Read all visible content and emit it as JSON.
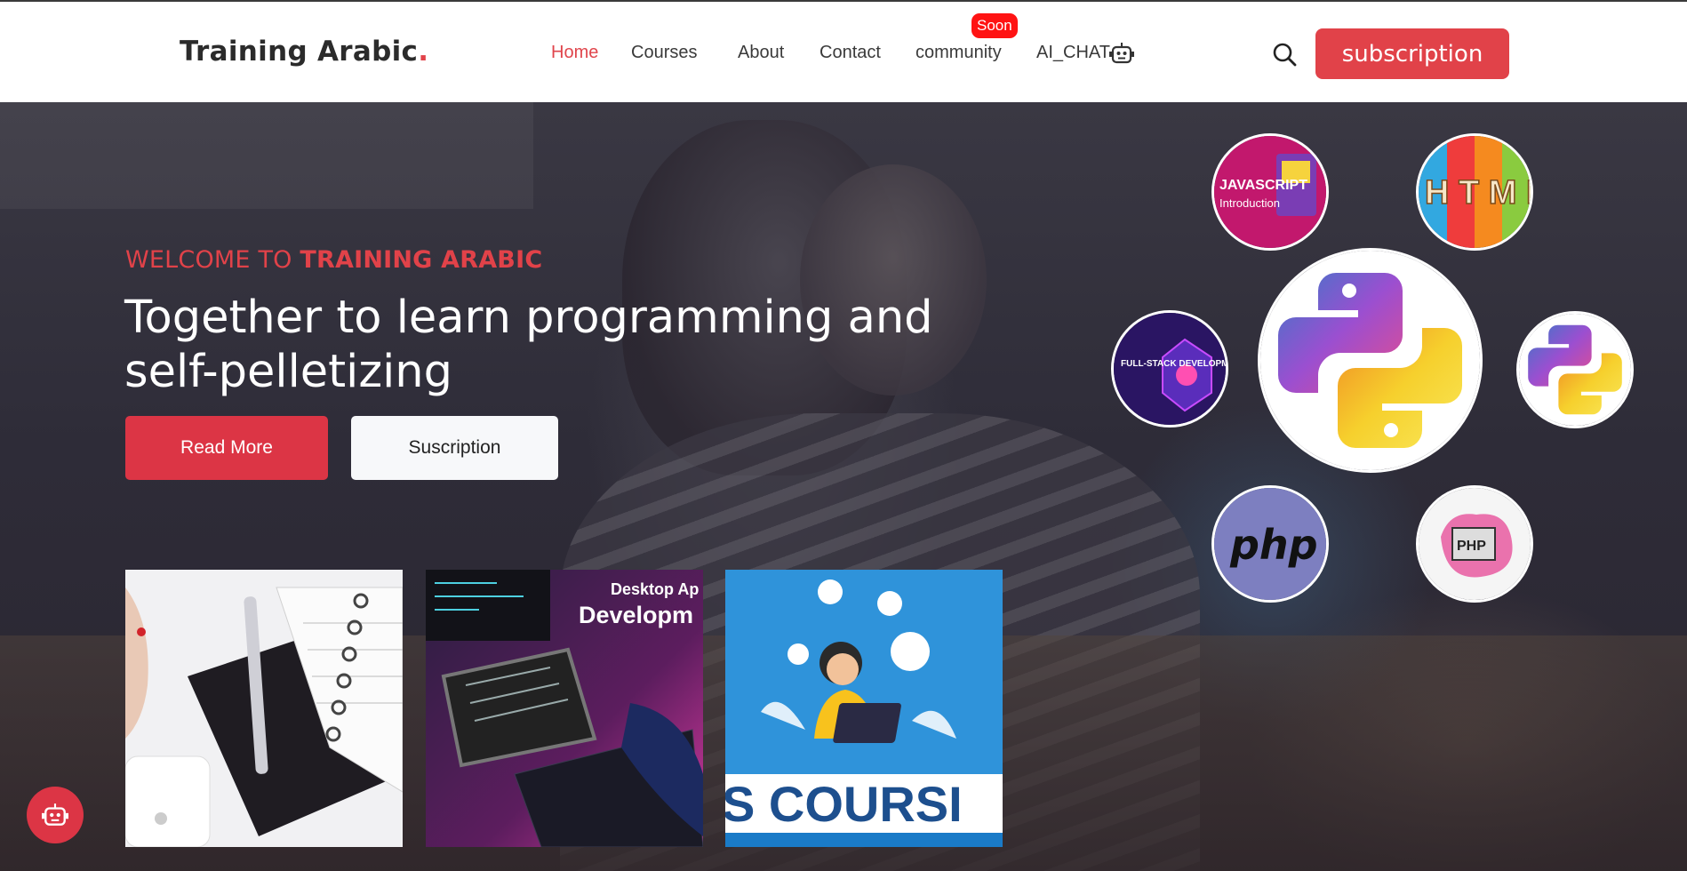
{
  "header": {
    "logo_text": "Training Arabic",
    "logo_dot": ".",
    "nav": {
      "home": "Home",
      "courses": "Courses",
      "about": "About",
      "contact": "Contact",
      "community": "community",
      "ai_chat": "AI_CHAT"
    },
    "soon_badge": "Soon",
    "subscription_label": "subscription"
  },
  "hero": {
    "welcome_prefix": "WELCOME TO ",
    "welcome_brand": "TRAINING ARABIC",
    "title": "Together to learn programming and self-pelletizing",
    "read_more_label": "Read More",
    "suscription_label": "Suscription"
  },
  "cards": {
    "desktop_line1": "Desktop Ap",
    "desktop_line2": "Developm",
    "courses_text": "S COURSI"
  },
  "circles": {
    "javascript": "JAVASCRIPT",
    "javascript_sub": "Introduction",
    "html": "H T M L",
    "fullstack": "FULL-STACK DEVELOPMENT",
    "php": "php",
    "php2": "PHP"
  },
  "colors": {
    "accent": "#e14249",
    "soon": "#ff1313"
  }
}
